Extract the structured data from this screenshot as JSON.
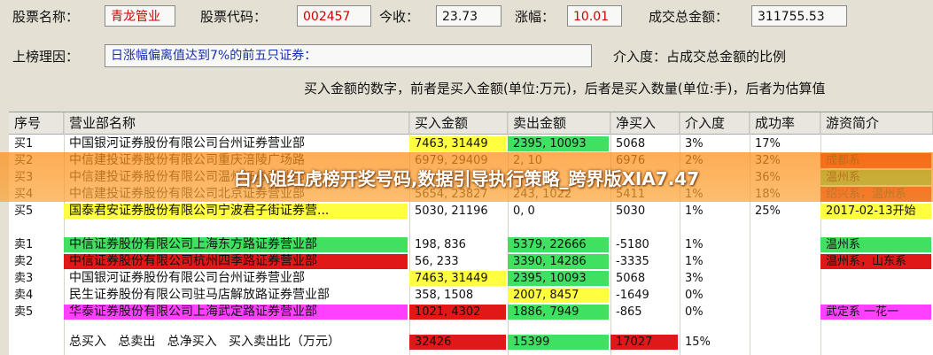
{
  "header": {
    "name_label": "股票名称：",
    "name_value": "青龙管业",
    "code_label": "股票代码：",
    "code_value": "002457",
    "close_label": "今收：",
    "close_value": "23.73",
    "change_label": "涨幅：",
    "change_value": "10.01",
    "amount_label": "成交总金额：",
    "amount_value": "311755.53",
    "reason_label": "上榜理因：",
    "reason_value": "日涨幅偏离值达到7%的前五只证券：",
    "involve_note": "介入度：占成交总金额的比例",
    "unit_note": "买入金额的数字，前者是买入金额(单位:万元)，后者是买入数量(单位:手)，后者为估算值"
  },
  "banner": {
    "text": "白小姐红虎榜开奖号码,数据引导执行策略_跨界版XIA7.47"
  },
  "table": {
    "headers": [
      "序号",
      "营业部名称",
      "买入金额",
      "卖出金额",
      "净买入",
      "介入度",
      "成功率",
      "游资简介"
    ],
    "rows": [
      {
        "seq": "买1",
        "name": "中国银河证券股份有限公司台州证券营业部",
        "buy": "7463, 31449",
        "sell": "2395, 10093",
        "net": "5068",
        "inv": "3%",
        "rate": "17%",
        "note": ""
      },
      {
        "seq": "买2",
        "name": "中信建投证券股份有限公司重庆涪陵广场路",
        "buy": "6979, 29409",
        "sell": "2, 10",
        "net": "6976",
        "inv": "2%",
        "rate": "32%",
        "note": "成都系"
      },
      {
        "seq": "买3",
        "name": "中信建投证券股份有限公司温州证券营业部",
        "buy": "",
        "sell": "",
        "net": "",
        "inv": "",
        "rate": "36%",
        "note": "温州系"
      },
      {
        "seq": "买4",
        "name": "中信建投证券股份有限公司北京证券营业部",
        "buy": "5654, 23827",
        "sell": "243, 1022",
        "net": "5411",
        "inv": "1%",
        "rate": "18%",
        "note": "绍兴系，温州系"
      },
      {
        "seq": "买5",
        "name": "国泰君安证券股份有限公司宁波君子街证券营...",
        "buy": "5030, 21196",
        "sell": "0, 0",
        "net": "5030",
        "inv": "1%",
        "rate": "25%",
        "note": "2017-02-13开始"
      },
      {
        "seq": "卖1",
        "name": "中信证券股份有限公司上海东方路证券营业部",
        "buy": "198, 836",
        "sell": "5379, 22666",
        "net": "-5180",
        "inv": "1%",
        "rate": "",
        "note": "温州系"
      },
      {
        "seq": "卖2",
        "name": "中信证券股份有限公司杭州四季路证券营业部",
        "buy": "56, 233",
        "sell": "3390, 14286",
        "net": "-3335",
        "inv": "1%",
        "rate": "",
        "note": "温州系，山东系"
      },
      {
        "seq": "卖3",
        "name": "中国银河证券股份有限公司台州证券营业部",
        "buy": "7463, 31449",
        "sell": "2395, 10093",
        "net": "5068",
        "inv": "3%",
        "rate": "",
        "note": ""
      },
      {
        "seq": "卖4",
        "name": "民生证券股份有限公司驻马店解放路证券营业部",
        "buy": "358, 1508",
        "sell": "2007, 8457",
        "net": "-1649",
        "inv": "0%",
        "rate": "",
        "note": ""
      },
      {
        "seq": "卖5",
        "name": "华泰证券股份有限公司上海武定路证券营业部",
        "buy": "1021, 4302",
        "sell": "1886, 7949",
        "net": "-865",
        "inv": "0%",
        "rate": "",
        "note": "武定系 一花一"
      }
    ],
    "summary": {
      "labels": "总买入   总卖出   总净买入   买入卖出比（万元）",
      "buy": "32426",
      "sell": "15399",
      "net": "17027",
      "inv": "15%"
    }
  },
  "colors": {
    "yellow": "#ffff40",
    "green": "#40e060",
    "red": "#e01818",
    "magenta": "#ff40ff",
    "lightgreen": "#90ee90",
    "orange_banner": "#f7941d"
  }
}
